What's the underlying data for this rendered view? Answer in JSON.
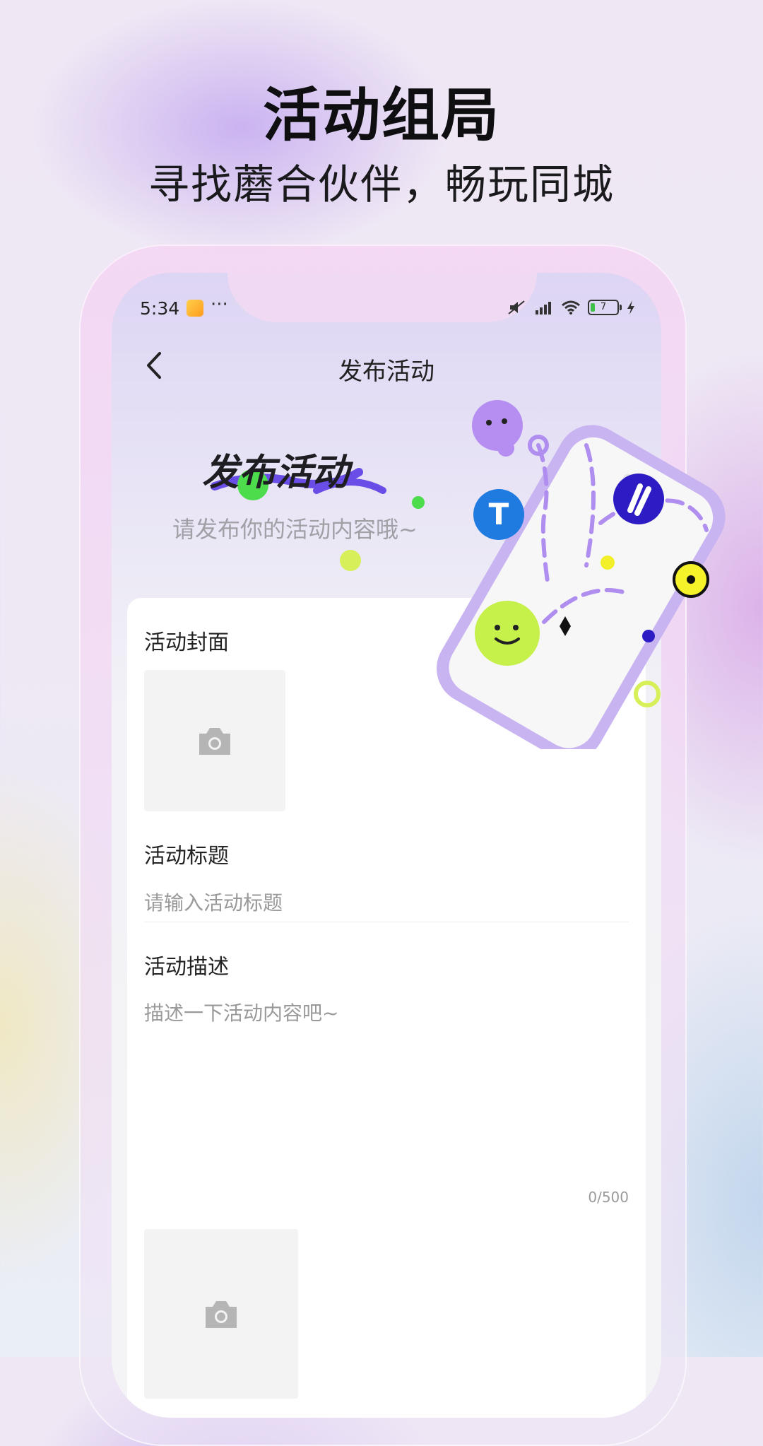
{
  "promo": {
    "headline": "活动组局",
    "subline": "寻找蘑合伙伴，畅玩同城"
  },
  "status_bar": {
    "time": "5:34",
    "dots": "···",
    "battery": "7"
  },
  "nav": {
    "title": "发布活动"
  },
  "hero": {
    "title": "发布活动",
    "subtitle": "请发布你的活动内容哦~"
  },
  "form": {
    "cover_label": "活动封面",
    "title_label": "活动标题",
    "title_placeholder": "请输入活动标题",
    "desc_label": "活动描述",
    "desc_placeholder": "描述一下活动内容吧~",
    "desc_counter": "0/500"
  },
  "colors": {
    "accent_purple": "#7a55e8",
    "lime": "#c6f04a",
    "blue_badge": "#1f7be0",
    "indigo_badge": "#2d1cc4"
  },
  "icons": [
    "back-arrow-icon",
    "camera-icon",
    "wifi-icon",
    "signal-icon",
    "battery-icon",
    "charging-icon",
    "mute-icon"
  ]
}
